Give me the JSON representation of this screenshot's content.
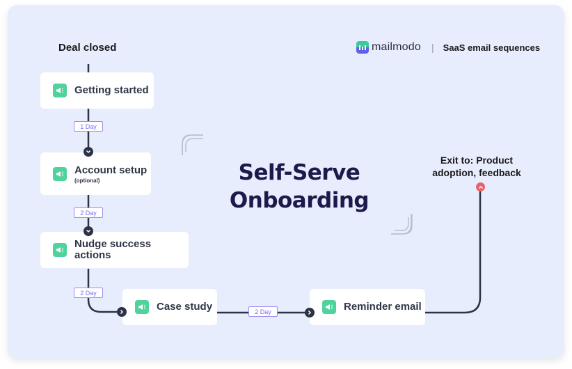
{
  "header": {
    "brand_name": "mailmodo",
    "separator": "|",
    "tagline": "SaaS email sequences"
  },
  "diagram": {
    "title_line1": "Self-Serve",
    "title_line2": "Onboarding",
    "start_label": "Deal closed",
    "exit_label_line1": "Exit to: Product",
    "exit_label_line2": "adoption, feedback",
    "steps": [
      {
        "label": "Getting started",
        "sublabel": null,
        "icon": "megaphone-icon"
      },
      {
        "label": "Account setup",
        "sublabel": "(optional)",
        "icon": "megaphone-icon"
      },
      {
        "label": "Nudge success actions",
        "sublabel": null,
        "icon": "megaphone-icon"
      },
      {
        "label": "Case study",
        "sublabel": null,
        "icon": "megaphone-icon"
      },
      {
        "label": "Reminder email",
        "sublabel": null,
        "icon": "megaphone-icon"
      }
    ],
    "delays": [
      "1 Day",
      "2 Day",
      "2 Day",
      "2 Day"
    ]
  },
  "colors": {
    "background": "#e8edfd",
    "node_icon": "#4fd29c",
    "connector": "#2b3344",
    "delay_pill": "#9b8cf0",
    "exit_marker": "#e8646a",
    "title": "#1c1a4a"
  }
}
